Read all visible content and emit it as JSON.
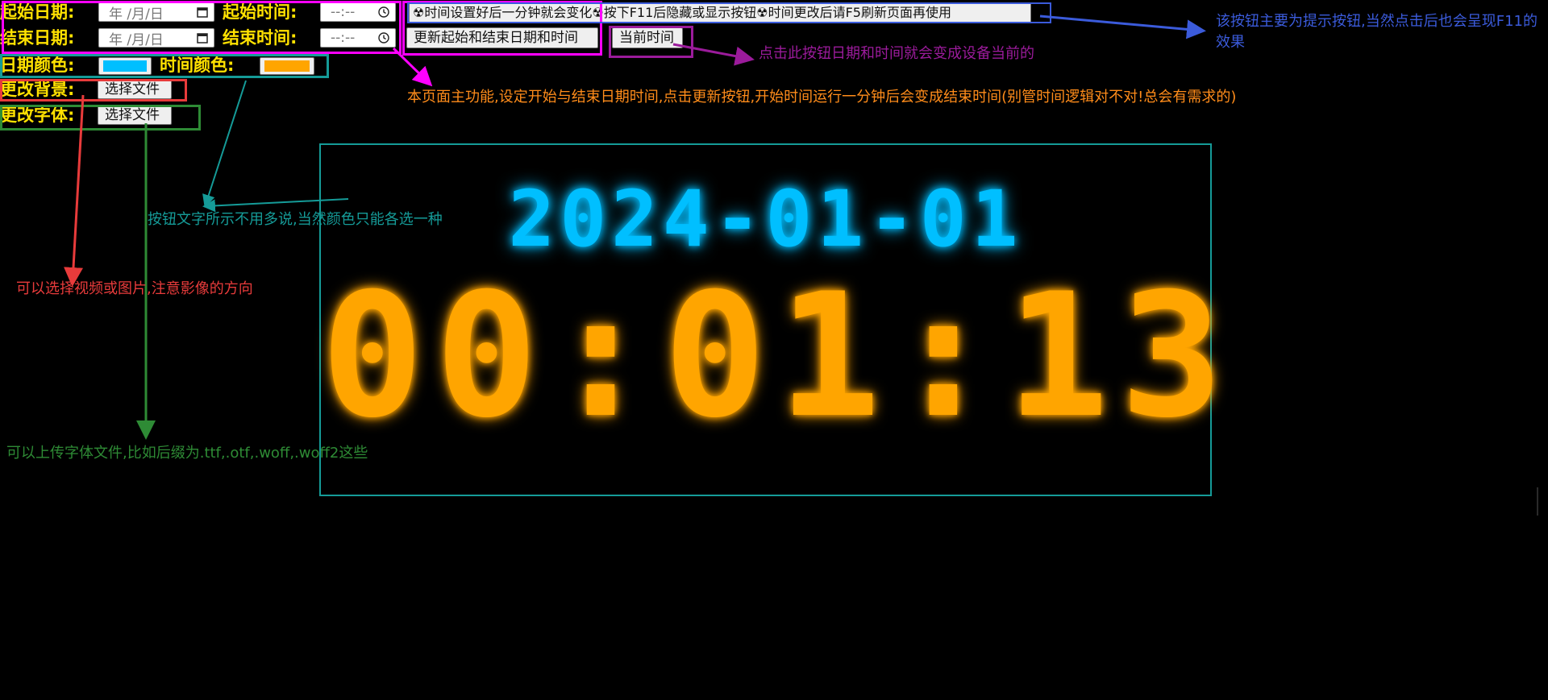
{
  "controls": {
    "start_date_label": "起始日期:",
    "start_time_label": "起始时间:",
    "end_date_label": "结束日期:",
    "end_time_label": "结束时间:",
    "date_placeholder": "年 /月/日",
    "time_placeholder": "--:--",
    "date_color_label": "日期颜色:",
    "time_color_label": "时间颜色:",
    "background_label": "更改背景:",
    "font_label": "更改字体:",
    "choose_file_label": "选择文件",
    "hint_button_label": "☢时间设置好后一分钟就会变化☢按下F11后隐藏或显示按钮☢时间更改后请F5刷新页面再使用",
    "update_button_label": "更新起始和结束日期和时间",
    "current_time_button_label": "当前时间"
  },
  "colors": {
    "date_color": "#00bfff",
    "time_color": "#ffa500"
  },
  "annotations": {
    "hint_button_note": "该按钮主要为提示按钮,当然点击后也会呈现F11的效果",
    "current_time_note": "点击此按钮日期和时间就会变成设备当前的",
    "main_function_note": "本页面主功能,设定开始与结束日期时间,点击更新按钮,开始时间运行一分钟后会变成结束时间(别管时间逻辑对不对!总会有需求的)",
    "color_note": "按钮文字所示不用多说,当然颜色只能各选一种",
    "background_note": "可以选择视频或图片,注意影像的方向",
    "font_note": "可以上传字体文件,比如后缀为.ttf,.otf,.woff,.woff2这些"
  },
  "clock": {
    "date": "2024-01-01",
    "time": "00:01:13"
  }
}
